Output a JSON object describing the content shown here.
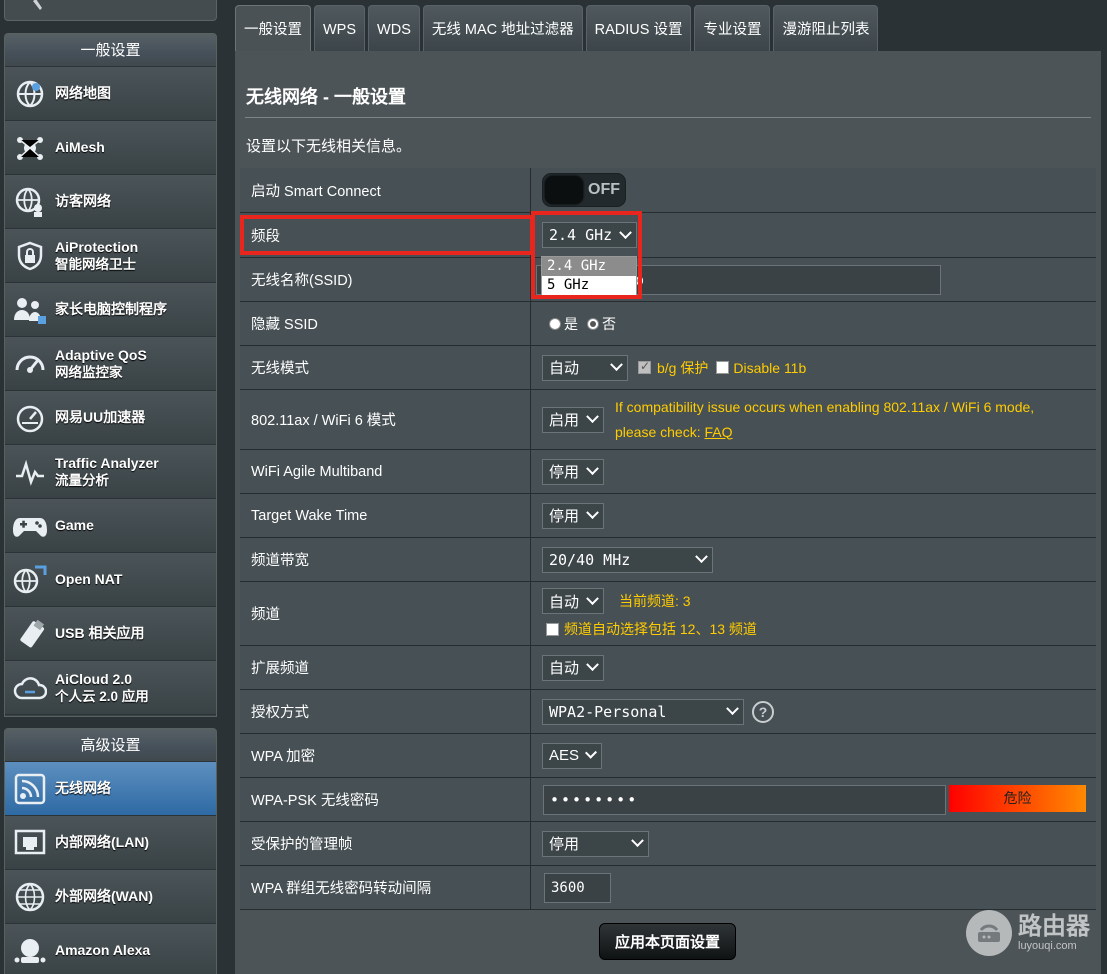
{
  "sidebar": {
    "general_header": "一般设置",
    "general_items": [
      {
        "icon": "network-map-icon",
        "lines": [
          "网络地图"
        ]
      },
      {
        "icon": "aimesh-icon",
        "lines": [
          "AiMesh"
        ]
      },
      {
        "icon": "guest-network-icon",
        "lines": [
          "访客网络"
        ]
      },
      {
        "icon": "shield-lock-icon",
        "lines": [
          "AiProtection",
          "智能网络卫士"
        ]
      },
      {
        "icon": "parental-control-icon",
        "lines": [
          "家长电脑控制程序"
        ]
      },
      {
        "icon": "speedometer-icon",
        "lines": [
          "Adaptive QoS",
          "网络监控家"
        ]
      },
      {
        "icon": "gauge-icon",
        "lines": [
          "网易UU加速器"
        ]
      },
      {
        "icon": "traffic-analyzer-icon",
        "lines": [
          "Traffic Analyzer",
          "流量分析"
        ]
      },
      {
        "icon": "gamepad-icon",
        "lines": [
          "Game"
        ]
      },
      {
        "icon": "open-nat-icon",
        "lines": [
          "Open NAT"
        ]
      },
      {
        "icon": "usb-icon",
        "lines": [
          "USB 相关应用"
        ]
      },
      {
        "icon": "cloud-icon",
        "lines": [
          "AiCloud 2.0",
          "个人云 2.0 应用"
        ]
      }
    ],
    "advanced_header": "高级设置",
    "advanced_items": [
      {
        "icon": "wireless-icon",
        "lines": [
          "无线网络"
        ],
        "active": true
      },
      {
        "icon": "lan-icon",
        "lines": [
          "内部网络(LAN)"
        ]
      },
      {
        "icon": "globe-icon",
        "lines": [
          "外部网络(WAN)"
        ]
      },
      {
        "icon": "alexa-icon",
        "lines": [
          "Amazon Alexa"
        ]
      }
    ]
  },
  "tabs": [
    "一般设置",
    "WPS",
    "WDS",
    "无线 MAC 地址过滤器",
    "RADIUS 设置",
    "专业设置",
    "漫游阻止列表"
  ],
  "page": {
    "title": "无线网络 - 一般设置",
    "description": "设置以下无线相关信息。"
  },
  "form": {
    "smart_connect": {
      "label": "启动 Smart Connect",
      "state": "OFF"
    },
    "band": {
      "label": "频段",
      "value": "2.4 GHz",
      "options": [
        "2.4 GHz",
        "5 GHz"
      ]
    },
    "ssid": {
      "label": "无线名称(SSID)",
      "value_tail": "o"
    },
    "hide_ssid": {
      "label": "隐藏 SSID",
      "yes": "是",
      "no": "否"
    },
    "wireless_mode": {
      "label": "无线模式",
      "value": "自动",
      "bg_protect": "b/g 保护",
      "disable_11b": "Disable 11b"
    },
    "ax_mode": {
      "label": "802.11ax / WiFi 6 模式",
      "value": "启用",
      "note_line1": "If compatibility issue occurs when enabling 802.11ax / WiFi 6 mode,",
      "note_line2_prefix": "please check: ",
      "faq": "FAQ"
    },
    "agile_multiband": {
      "label": "WiFi Agile Multiband",
      "value": "停用"
    },
    "target_wake_time": {
      "label": "Target Wake Time",
      "value": "停用"
    },
    "bandwidth": {
      "label": "频道带宽",
      "value": "20/40 MHz"
    },
    "channel": {
      "label": "频道",
      "value": "自动",
      "current": "当前频道: 3",
      "auto_include": "频道自动选择包括 12、13 频道"
    },
    "ext_channel": {
      "label": "扩展频道",
      "value": "自动"
    },
    "auth_method": {
      "label": "授权方式",
      "value": "WPA2-Personal"
    },
    "wpa_encryption": {
      "label": "WPA 加密",
      "value": "AES"
    },
    "wpa_psk": {
      "label": "WPA-PSK 无线密码",
      "value": "••••••••",
      "strength": "危险"
    },
    "pmf": {
      "label": "受保护的管理帧",
      "value": "停用"
    },
    "group_key_interval": {
      "label": "WPA 群组无线密码转动间隔",
      "value": "3600"
    }
  },
  "apply_button": "应用本页面设置",
  "watermark": {
    "title": "路由器",
    "url": "luyouqi.com"
  }
}
